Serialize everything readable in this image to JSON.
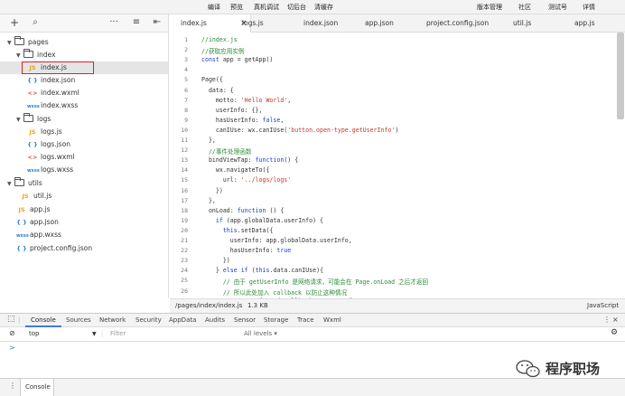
{
  "menu": [
    "编译",
    "预览",
    "真机调试",
    "切后台",
    "清缓存",
    "版本管理",
    "社区",
    "测试号",
    "详情"
  ],
  "file_toolbar": {
    "add": "+",
    "search": "⌕",
    "more": "···",
    "sort": "≡",
    "collapse": "⇤"
  },
  "tree": [
    {
      "label": "pages",
      "type": "folder",
      "depth": 0
    },
    {
      "label": "index",
      "type": "folder",
      "depth": 1
    },
    {
      "label": "index.js",
      "type": "js",
      "icon": "JS",
      "depth": 2
    },
    {
      "label": "index.json",
      "type": "json",
      "icon": "{ }",
      "depth": 2
    },
    {
      "label": "index.wxml",
      "type": "wxml",
      "icon": "<>",
      "depth": 2
    },
    {
      "label": "index.wxss",
      "type": "wxss",
      "icon": "wxss",
      "depth": 2
    },
    {
      "label": "logs",
      "type": "folder",
      "depth": 1
    },
    {
      "label": "logs.js",
      "type": "js",
      "icon": "JS",
      "depth": 2
    },
    {
      "label": "logs.json",
      "type": "json",
      "icon": "{ }",
      "depth": 2
    },
    {
      "label": "logs.wxml",
      "type": "wxml",
      "icon": "<>",
      "depth": 2
    },
    {
      "label": "logs.wxss",
      "type": "wxss",
      "icon": "wxss",
      "depth": 2
    },
    {
      "label": "utils",
      "type": "folder",
      "depth": 0
    },
    {
      "label": "util.js",
      "type": "js",
      "icon": "JS",
      "depth": 1
    },
    {
      "label": "app.js",
      "type": "js",
      "icon": "JS",
      "depth": 0
    },
    {
      "label": "app.json",
      "type": "json",
      "icon": "{ }",
      "depth": 0
    },
    {
      "label": "app.wxss",
      "type": "wxss",
      "icon": "wxss",
      "depth": 0
    },
    {
      "label": "project.config.json",
      "type": "json",
      "icon": "{ }",
      "depth": 0
    }
  ],
  "tabs": [
    "index.js",
    "logs.js",
    "index.json",
    "app.json",
    "project.config.json",
    "util.js",
    "app.js"
  ],
  "tab_close": "×",
  "code": [
    "//index.js",
    "//获取应用实例",
    "const app = getApp()",
    "",
    "Page({",
    "  data: {",
    "    motto: 'Hello World',",
    "    userInfo: {},",
    "    hasUserInfo: false,",
    "    canIUse: wx.canIUse('button.open-type.getUserInfo')",
    "  },",
    "  //事件处理函数",
    "  bindViewTap: function() {",
    "    wx.navigateTo({",
    "      url: '../logs/logs'",
    "    })",
    "  },",
    "  onLoad: function () {",
    "    if (app.globalData.userInfo) {",
    "      this.setData({",
    "        userInfo: app.globalData.userInfo,",
    "        hasUserInfo: true",
    "      })",
    "    } else if (this.data.canIUse){",
    "      // 由于 getUserInfo 是网络请求，可能会在 Page.onLoad 之后才返回",
    "      // 所以此处加入 callback 以防止这种情况",
    "      app.userInfoReadyCallback = res => {"
  ],
  "status": {
    "path": "/pages/index/index.js",
    "size": "1.3 KB",
    "lang": "JavaScript"
  },
  "devtools_tabs": [
    "Console",
    "Sources",
    "Network",
    "Security",
    "AppData",
    "Audits",
    "Sensor",
    "Storage",
    "Trace",
    "Wxml"
  ],
  "console": {
    "context": "top",
    "filter_placeholder": "Filter",
    "levels": "All levels ▾",
    "prompt": ">"
  },
  "drawer": {
    "tab": "Console"
  },
  "watermark": "程序职场"
}
